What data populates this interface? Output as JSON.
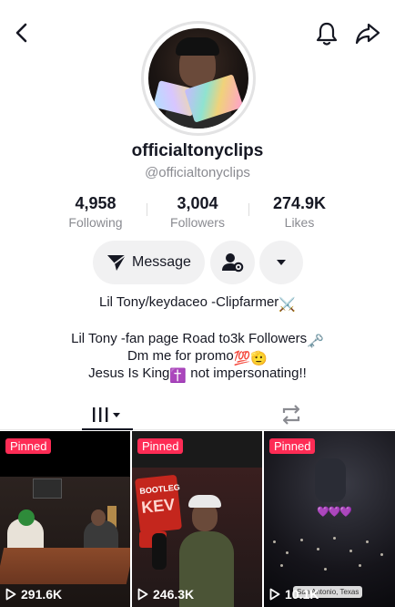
{
  "header": {
    "back_icon": "chevron-left-icon",
    "bell_icon": "bell-icon",
    "share_icon": "share-arrow-icon"
  },
  "profile": {
    "username": "officialtonyclips",
    "handle": "@officialtonyclips"
  },
  "stats": [
    {
      "value": "4,958",
      "label": "Following"
    },
    {
      "value": "3,004",
      "label": "Followers"
    },
    {
      "value": "274.9K",
      "label": "Likes"
    }
  ],
  "actions": {
    "message_label": "Message",
    "friend_icon": "add-friend-settings-icon",
    "more_icon": "caret-down-icon"
  },
  "bio": {
    "line1": "Lil Tony/keydaceo -Clipfarmer",
    "line1_emoji": "⚔️",
    "line2": "Lil Tony -fan page  Road to3k Followers",
    "line2_emoji": "🗝️",
    "line3": "Dm me for promo",
    "line3_emoji": "💯🫡",
    "line4_pre": "Jesus Is King",
    "line4_emoji": "✝️",
    "line4_post": " not impersonating!!"
  },
  "tabs": {
    "videos_icon": "grid-lines-icon",
    "repost_icon": "repost-icon"
  },
  "videos": [
    {
      "pinned": "Pinned",
      "views": "291.6K"
    },
    {
      "pinned": "Pinned",
      "views": "246.3K",
      "overlay_top": "BOOTLEG",
      "overlay_bottom": "KEV"
    },
    {
      "pinned": "Pinned",
      "views": "10.1K",
      "location": "San Antonio, Texas",
      "hearts": "💜💜💜"
    }
  ],
  "colors": {
    "pinned_badge": "#fe2c55",
    "secondary_text": "#8a8b91",
    "button_bg": "#f1f1f2"
  }
}
